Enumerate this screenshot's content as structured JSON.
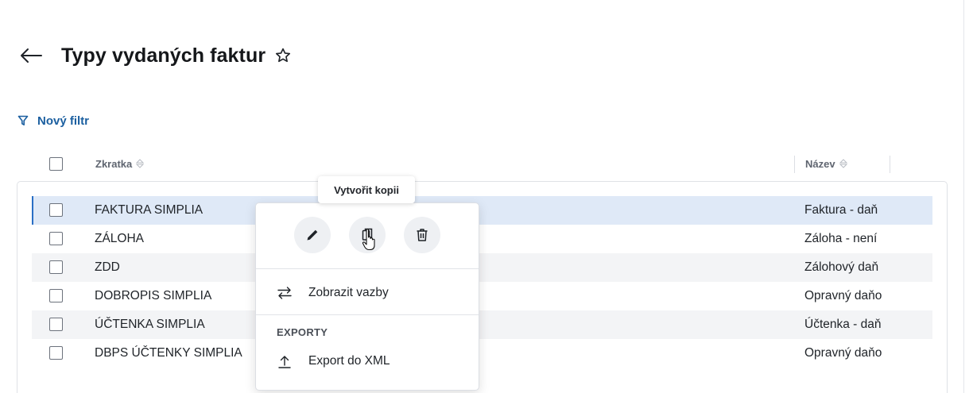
{
  "header": {
    "title": "Typy vydaných faktur",
    "back_icon": "arrow-left-icon",
    "favorite_icon": "star-outline-icon"
  },
  "filter": {
    "label": "Nový filtr",
    "icon": "filter-icon"
  },
  "table": {
    "columns": [
      {
        "label": "Zkratka",
        "sort_icon": "sort-icon"
      },
      {
        "label": "Název",
        "sort_icon": "sort-icon"
      }
    ],
    "rows": [
      {
        "code": "FAKTURA SIMPLIA",
        "name": "Faktura - daň",
        "selected": true
      },
      {
        "code": "ZÁLOHA",
        "name": "Záloha - není",
        "selected": false
      },
      {
        "code": "ZDD",
        "name": "Zálohový daň",
        "selected": false
      },
      {
        "code": "DOBROPIS SIMPLIA",
        "name": "Opravný daňo",
        "selected": false
      },
      {
        "code": "ÚČTENKA SIMPLIA",
        "name": "Účtenka - daň",
        "selected": false
      },
      {
        "code": "DBPS ÚČTENKY SIMPLIA",
        "name": "Opravný daňo",
        "selected": false
      }
    ]
  },
  "context_menu": {
    "tooltip": "Vytvořit kopii",
    "actions": [
      {
        "icon": "pencil-icon"
      },
      {
        "icon": "copy-icon"
      },
      {
        "icon": "trash-icon"
      }
    ],
    "items": [
      {
        "label": "Zobrazit vazby",
        "icon": "swap-arrows-icon"
      }
    ],
    "exports_title": "EXPORTY",
    "export_items": [
      {
        "label": "Export do XML",
        "icon": "upload-icon"
      }
    ]
  },
  "colors": {
    "accent": "#1b5fa0",
    "selected_row": "#dfe9f7",
    "alt_row": "#f3f4f6"
  }
}
